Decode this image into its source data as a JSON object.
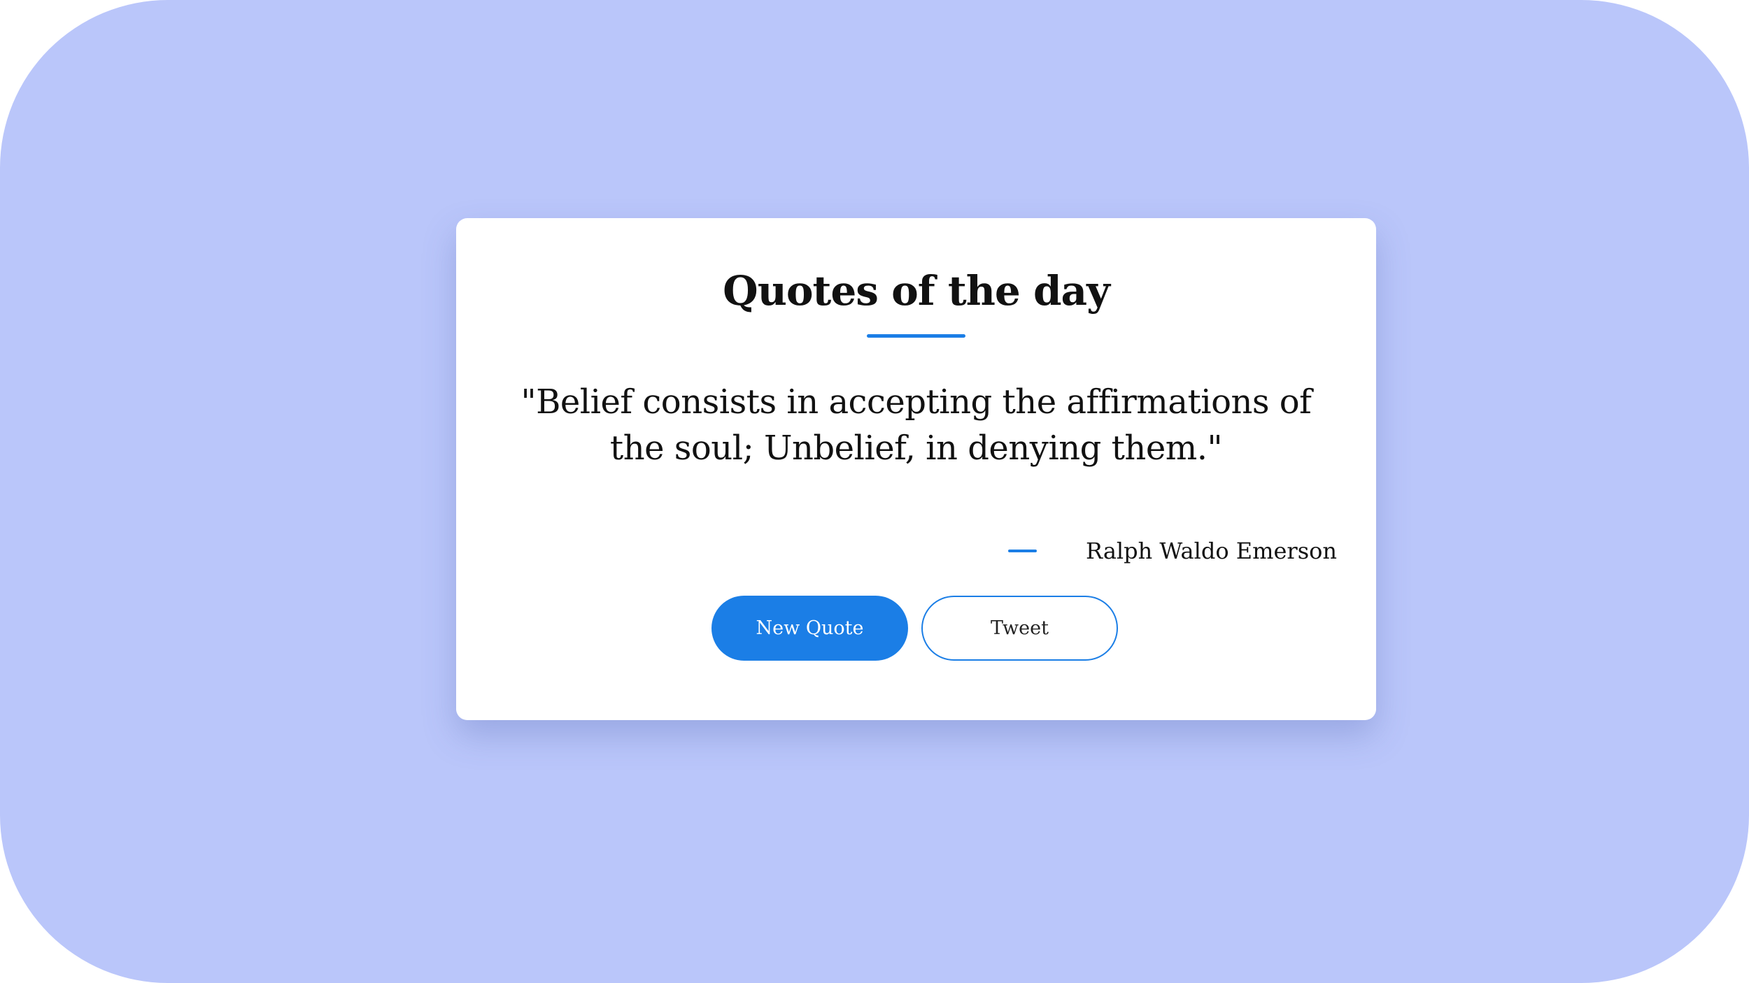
{
  "colors": {
    "background": "#bac6fa",
    "card": "#ffffff",
    "accent": "#1b7ee6",
    "text": "#111111"
  },
  "card": {
    "title": "Quotes of the day",
    "quote_text": "\"Belief consists in accepting the affirmations of the soul; Unbelief, in denying them.\"",
    "author": "Ralph Waldo Emerson"
  },
  "actions": {
    "new_quote_label": "New Quote",
    "tweet_label": "Tweet"
  }
}
